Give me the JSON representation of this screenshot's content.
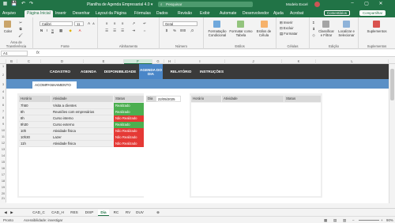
{
  "titlebar": {
    "autosave": "AutoSave",
    "title": "Planilha de Agenda Empresarial 4.0 ▾",
    "search": "Pesquisar",
    "user": "Modelo Excel"
  },
  "menu": {
    "tabs": [
      "Arquivo",
      "Página Inicial",
      "Inserir",
      "Desenhar",
      "Layout da Página",
      "Fórmulas",
      "Dados",
      "Revisão",
      "Exibir",
      "Automate",
      "Desenvolvedor",
      "Ajuda",
      "Acrobat"
    ],
    "comments": "Comentários",
    "share": "Compartilhar"
  },
  "ribbon": {
    "paste": "Colar",
    "clipboard": "Área de Transferência",
    "font_name": "Calibri",
    "font_size": "11",
    "font_group": "Fonte",
    "alignment": "Alinhamento",
    "number_format": "Geral",
    "number_group": "Número",
    "cond_format": "Formatação Condicional",
    "format_table": "Formatar como Tabela",
    "cell_styles": "Estilos de Célula",
    "styles_group": "Estilos",
    "insert": "Inserir",
    "delete": "Excluir",
    "format": "Formatar",
    "cells_group": "Células",
    "sort": "Classificar e Filtrar",
    "find": "Localizar e Selecionar",
    "editing_group": "Edição",
    "addins": "Suplementos",
    "addins_group": "Suplementos"
  },
  "formula_bar": {
    "namebox": "A1",
    "fx": "fx",
    "value": ""
  },
  "columns": [
    "B",
    "C",
    "D",
    "E",
    "F",
    "G",
    "H",
    "I",
    "J",
    "K",
    "L"
  ],
  "rows": [
    "1",
    "2",
    "3",
    "4",
    "5",
    "6",
    "7",
    "8",
    "9",
    "10",
    "11",
    "12",
    "13",
    "14",
    "15",
    "16",
    "17",
    "18",
    "19",
    "20",
    "21",
    "22",
    "23",
    "24",
    "25",
    "26",
    "27",
    "28"
  ],
  "nav": {
    "items": [
      "CADASTRO",
      "AGENDA",
      "DISPONIBILIDADE",
      "AGENDA DO DIA",
      "RELATÓRIO",
      "INSTRUÇÕES"
    ],
    "active": "AGENDA DO DIA"
  },
  "subtab": "ACOMPANHAMENTO",
  "left_table": {
    "headers": [
      "Horário",
      "Atividade",
      "Status"
    ],
    "rows": [
      {
        "time": "7h50",
        "activity": "Visita a clientes",
        "status": "Realizado",
        "color": "#4caf50"
      },
      {
        "time": "8h",
        "activity": "Reuniões com empresários",
        "status": "Realizado",
        "color": "#4caf50"
      },
      {
        "time": "8h",
        "activity": "Curso interno",
        "status": "Não Realizado",
        "color": "#e53935"
      },
      {
        "time": "9h30",
        "activity": "Curso externo",
        "status": "Realizado",
        "color": "#4caf50"
      },
      {
        "time": "10h",
        "activity": "Atividade física",
        "status": "Não Realizado",
        "color": "#e53935"
      },
      {
        "time": "10h30",
        "activity": "Lazer",
        "status": "Não Realizado",
        "color": "#e53935"
      },
      {
        "time": "11h",
        "activity": "Atividade física",
        "status": "Não Realizado",
        "color": "#e53935"
      }
    ]
  },
  "day": {
    "label": "Dia",
    "value": "22/05/2025"
  },
  "right_table": {
    "headers": [
      "Horário",
      "Atividade",
      "Status"
    ]
  },
  "sheet_tabs": [
    "CAD_C",
    "CAD_H",
    "RES",
    "DISP",
    "Dia",
    "RC",
    "RV",
    "DUV"
  ],
  "active_sheet": "Dia",
  "status": {
    "ready": "Pronto",
    "accessibility": "Acessibilidade: investigar",
    "zoom": "90%"
  }
}
